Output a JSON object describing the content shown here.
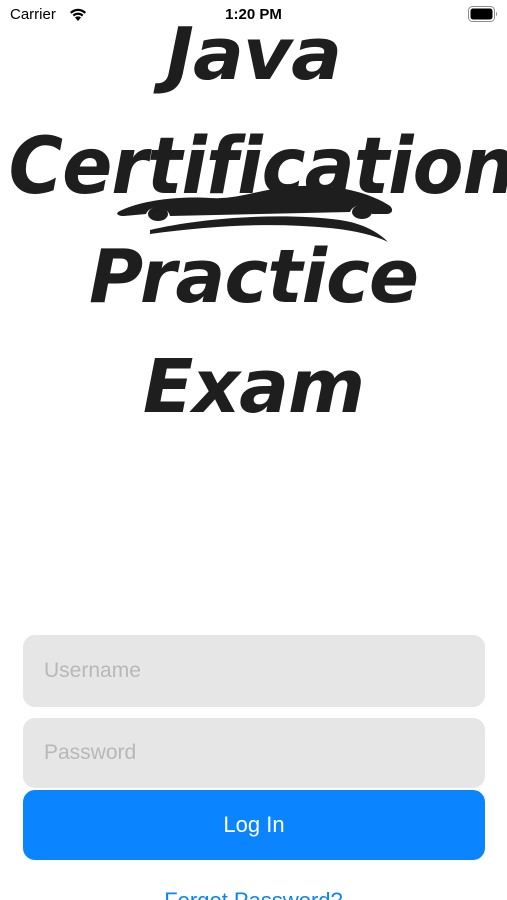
{
  "status_bar": {
    "carrier": "Carrier",
    "time": "1:20 PM",
    "wifi_icon": "wifi-icon",
    "battery_icon": "battery-icon"
  },
  "logo": {
    "lines": [
      "Java",
      "Certification",
      "Practice",
      "Exam"
    ],
    "art_icon": "car-silhouette",
    "color": "#1e1e1e"
  },
  "form": {
    "username_placeholder": "Username",
    "username_value": "",
    "password_placeholder": "Password",
    "password_value": "",
    "login_label": "Log In",
    "forgot_label": "Forgot Password?"
  },
  "colors": {
    "accent": "#0a84ff",
    "field_background": "#e6e6e6",
    "placeholder": "#b8b8b8"
  }
}
